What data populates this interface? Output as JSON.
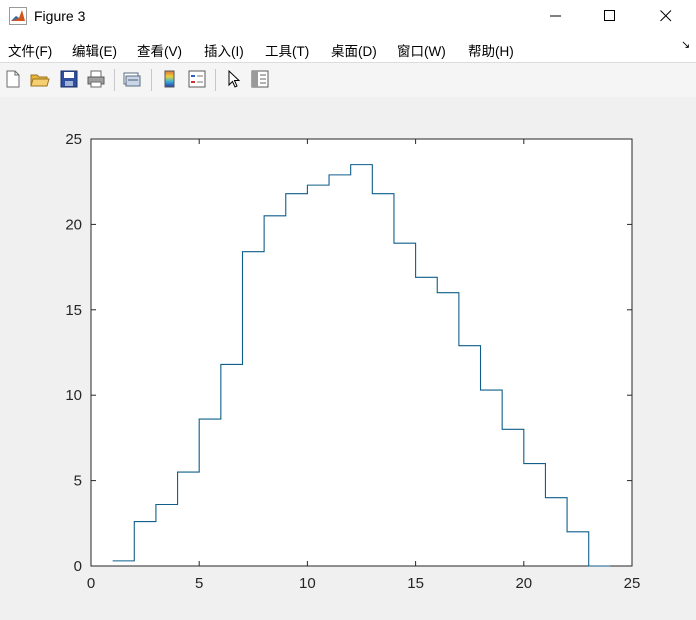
{
  "window": {
    "title": "Figure 3"
  },
  "menu": {
    "items": [
      {
        "label": "文件(F)"
      },
      {
        "label": "编辑(E)"
      },
      {
        "label": "查看(V)"
      },
      {
        "label": "插入(I)"
      },
      {
        "label": "工具(T)"
      },
      {
        "label": "桌面(D)"
      },
      {
        "label": "窗口(W)"
      },
      {
        "label": "帮助(H)"
      }
    ]
  },
  "toolbar": {
    "buttons": [
      "new-figure-icon",
      "open-file-icon",
      "save-icon",
      "print-icon",
      "link-plot-icon",
      "insert-colorbar-icon",
      "insert-legend-icon",
      "edit-plot-pointer-icon",
      "property-inspector-icon"
    ]
  },
  "colors": {
    "line": "#0f5f8a",
    "axes": "#262626"
  },
  "chart_data": {
    "type": "line",
    "style": "stairs",
    "x": [
      1,
      2,
      3,
      4,
      5,
      6,
      7,
      8,
      9,
      10,
      11,
      12,
      13,
      14,
      15,
      16,
      17,
      18,
      19,
      20,
      21,
      22,
      23,
      24
    ],
    "values": [
      0.3,
      2.6,
      3.6,
      5.5,
      8.6,
      11.8,
      18.4,
      20.5,
      21.8,
      22.3,
      22.9,
      23.5,
      21.8,
      18.9,
      16.9,
      16.0,
      12.9,
      10.3,
      8.0,
      6.0,
      4.0,
      2.0,
      0.0,
      0.0
    ],
    "xlim": [
      0,
      25
    ],
    "ylim": [
      0,
      25
    ],
    "xticks": [
      "0",
      "5",
      "10",
      "15",
      "20",
      "25"
    ],
    "yticks": [
      "0",
      "5",
      "10",
      "15",
      "20",
      "25"
    ],
    "grid": false,
    "title": "",
    "xlabel": "",
    "ylabel": ""
  }
}
